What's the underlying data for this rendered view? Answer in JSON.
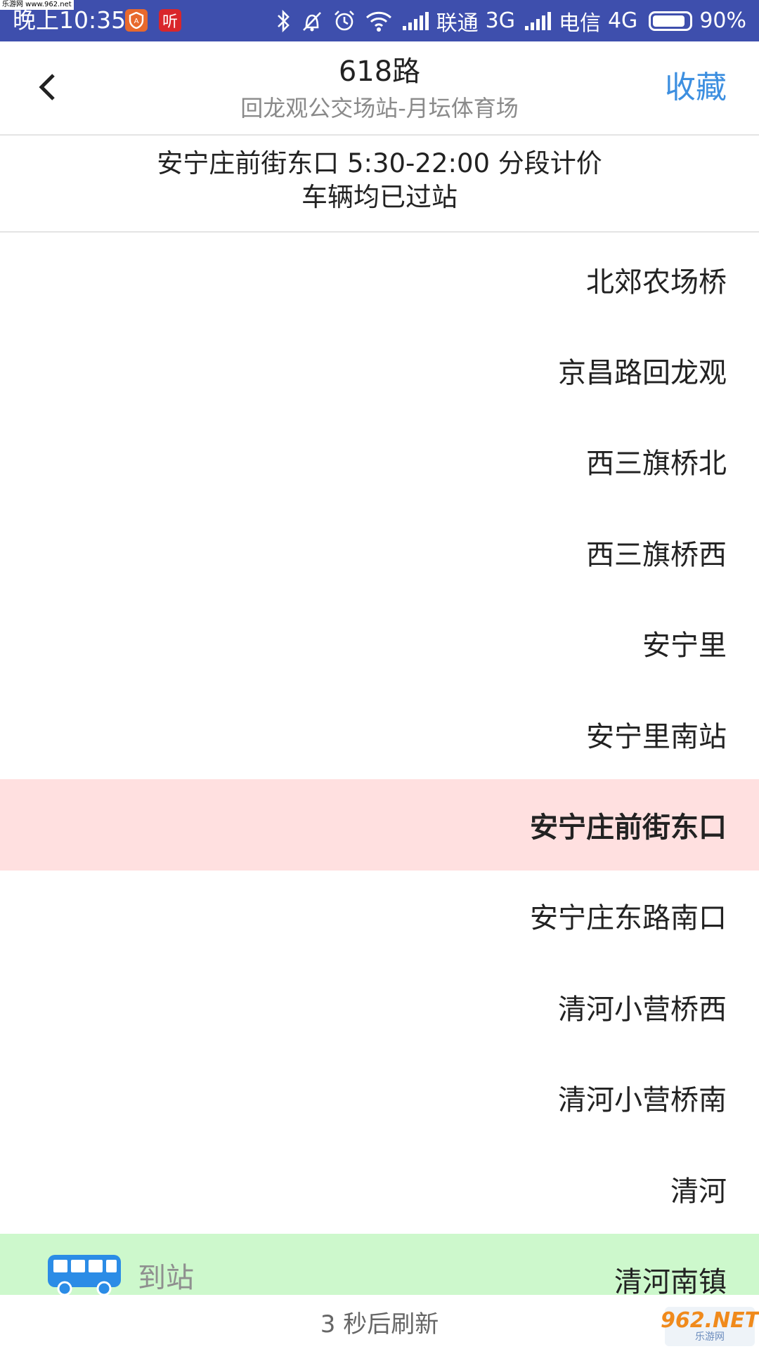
{
  "watermark_top": "乐游网 www.962.net",
  "status_bar": {
    "time": "晚上10:35",
    "app1_icon": "shield-app-icon",
    "app2_label": "听",
    "carrier1": "联通",
    "network1": "3G",
    "carrier2": "电信",
    "network2": "4G",
    "battery": "90%",
    "battery_level": 0.9
  },
  "header": {
    "title": "618路",
    "subtitle": "回龙观公交场站-月坛体育场",
    "favorite_label": "收藏"
  },
  "info": {
    "line1": "安宁庄前街东口 5:30-22:00 分段计价",
    "line2": "车辆均已过站"
  },
  "stations": [
    "北郊农场桥",
    "京昌路回龙观",
    "西三旗桥北",
    "西三旗桥西",
    "安宁里",
    "安宁里南站",
    "安宁庄前街东口",
    "安宁庄东路南口",
    "清河小营桥西",
    "清河小营桥南",
    "清河",
    "清河南镇"
  ],
  "current_station": "安宁庄前街东口",
  "bus_status": "到站",
  "footer": {
    "refresh_text": "3 秒后刷新"
  },
  "watermark_bottom": {
    "logo": "962.NET",
    "sub": "乐游网"
  },
  "colors": {
    "status_bar": "#3e4fad",
    "accent": "#3d8fe0",
    "current_bg": "#ffe0e0",
    "arriving_bg": "#cdf8cc",
    "bus_icon": "#2b8ce6"
  }
}
